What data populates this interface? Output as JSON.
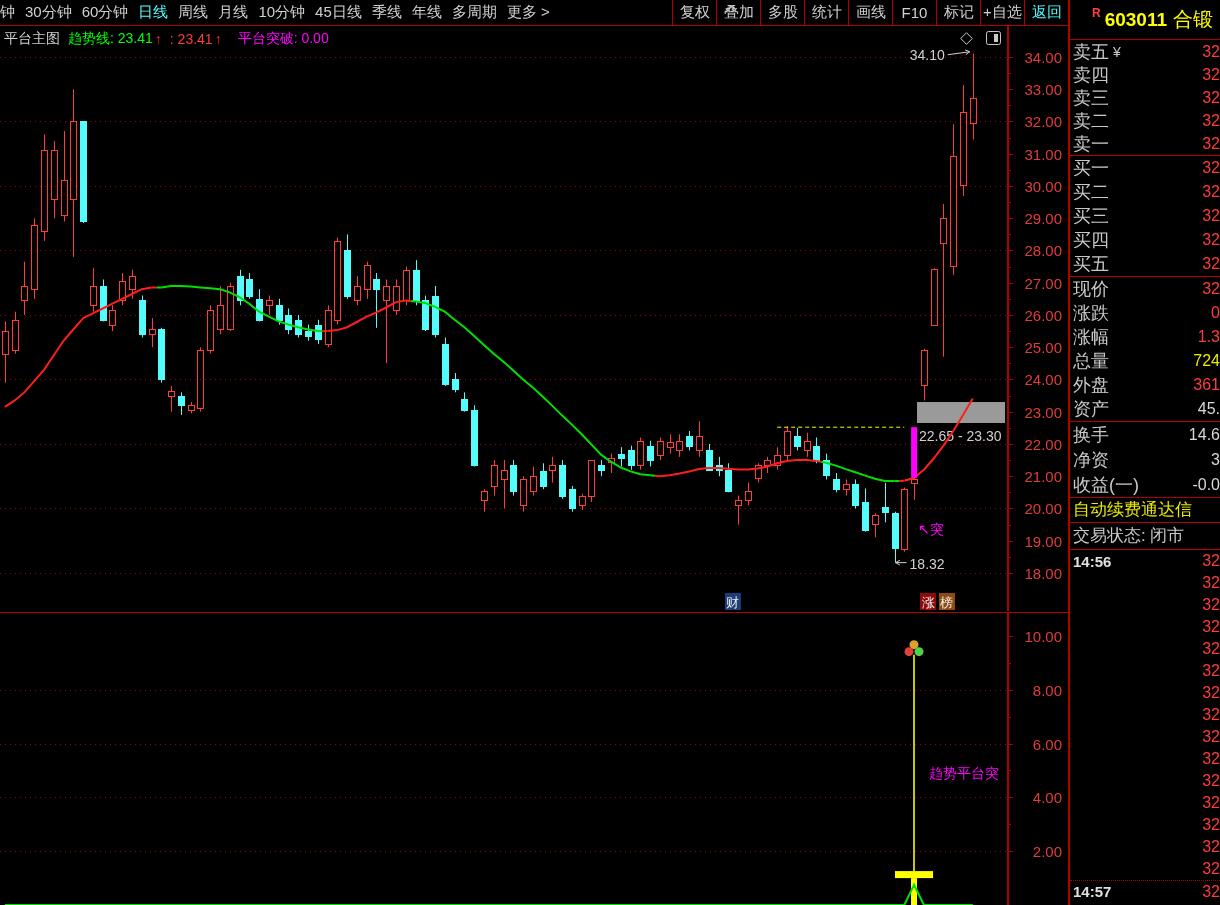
{
  "toolbar": {
    "periods": [
      {
        "label": "钟",
        "selected": false
      },
      {
        "label": "30分钟",
        "selected": false
      },
      {
        "label": "60分钟",
        "selected": false
      },
      {
        "label": "日线",
        "selected": true
      },
      {
        "label": "周线",
        "selected": false
      },
      {
        "label": "月线",
        "selected": false
      },
      {
        "label": "10分钟",
        "selected": false
      },
      {
        "label": "45日线",
        "selected": false
      },
      {
        "label": "季线",
        "selected": false
      },
      {
        "label": "年线",
        "selected": false
      },
      {
        "label": "多周期",
        "selected": false
      },
      {
        "label": "更多 >",
        "selected": false
      }
    ],
    "buttons": [
      {
        "label": "复权",
        "kind": "tool"
      },
      {
        "label": "叠加",
        "kind": "tool"
      },
      {
        "label": "多股",
        "kind": "tool"
      },
      {
        "label": "统计",
        "kind": "tool"
      },
      {
        "label": "画线",
        "kind": "tool"
      },
      {
        "label": "F10",
        "kind": "tool"
      },
      {
        "label": "标记",
        "kind": "tool"
      },
      {
        "label": "+自选",
        "kind": "tool"
      },
      {
        "label": "返回",
        "kind": "back"
      }
    ]
  },
  "chart": {
    "legend": {
      "title": "平台主图",
      "items": [
        {
          "label": "趋势线: 23.41",
          "arrow": "↑",
          "color": "#00ff00"
        },
        {
          "label": ": 23.41",
          "arrow": "↑",
          "color": "#ff3c3c"
        },
        {
          "label": "平台突破: 0.00",
          "color": "#ff00ff"
        }
      ]
    },
    "chart_data": {
      "type": "candlestick",
      "ylim": [
        16.82,
        34.96
      ],
      "grid": true,
      "yticks": [
        {
          "value": 34,
          "label": "34.00"
        },
        {
          "value": 33,
          "label": "33.00"
        },
        {
          "value": 32,
          "label": "32.00"
        },
        {
          "value": 31,
          "label": "31.00"
        },
        {
          "value": 30,
          "label": "30.00"
        },
        {
          "value": 29,
          "label": "29.00"
        },
        {
          "value": 28,
          "label": "28.00"
        },
        {
          "value": 27,
          "label": "27.00"
        },
        {
          "value": 26,
          "label": "26.00"
        },
        {
          "value": 25,
          "label": "25.00"
        },
        {
          "value": 24,
          "label": "24.00"
        },
        {
          "value": 23,
          "label": "23.00"
        },
        {
          "value": 22,
          "label": "22.00"
        },
        {
          "value": 21,
          "label": "21.00"
        },
        {
          "value": 20,
          "label": "20.00"
        },
        {
          "value": 19,
          "label": "19.00"
        },
        {
          "value": 18,
          "label": "18.00"
        }
      ],
      "series": [
        {
          "ohlc": [
            [
              24.8,
              25.8,
              23.9,
              25.5
            ],
            [
              24.9,
              26.1,
              24.8,
              25.85
            ],
            [
              26.45,
              27.65,
              26.0,
              26.9
            ],
            [
              26.8,
              29.0,
              26.5,
              28.8
            ],
            [
              28.6,
              31.6,
              28.3,
              31.1
            ],
            [
              29.6,
              31.4,
              29.0,
              31.1
            ],
            [
              29.1,
              31.7,
              28.9,
              30.2
            ],
            [
              29.6,
              33.0,
              27.8,
              32.0
            ],
            [
              32.0,
              32.0,
              28.85,
              28.9
            ],
            [
              26.3,
              27.45,
              26.1,
              26.9
            ],
            [
              26.9,
              27.1,
              25.8,
              25.85
            ],
            [
              25.7,
              26.3,
              25.5,
              26.15
            ],
            [
              26.45,
              27.3,
              26.3,
              27.05
            ],
            [
              26.8,
              27.4,
              26.5,
              27.2
            ],
            [
              26.45,
              26.6,
              25.3,
              25.4
            ],
            [
              25.4,
              25.9,
              25.0,
              25.55
            ],
            [
              25.55,
              25.6,
              23.9,
              24.0
            ],
            [
              23.5,
              23.8,
              23.0,
              23.65
            ],
            [
              23.5,
              23.6,
              22.9,
              23.2
            ],
            [
              23.05,
              23.3,
              22.95,
              23.2
            ],
            [
              23.1,
              25.0,
              23.0,
              24.9
            ],
            [
              24.9,
              26.3,
              24.8,
              26.15
            ],
            [
              25.55,
              26.9,
              25.4,
              26.3
            ],
            [
              25.55,
              27.0,
              25.5,
              26.9
            ],
            [
              27.2,
              27.4,
              26.3,
              26.45
            ],
            [
              27.1,
              27.3,
              26.5,
              26.6
            ],
            [
              26.5,
              26.8,
              25.8,
              25.85
            ],
            [
              26.3,
              26.6,
              26.0,
              26.45
            ],
            [
              26.3,
              26.5,
              25.7,
              25.85
            ],
            [
              26.0,
              26.2,
              25.4,
              25.55
            ],
            [
              25.85,
              26.0,
              25.3,
              25.4
            ],
            [
              25.5,
              25.7,
              25.2,
              25.35
            ],
            [
              25.7,
              25.85,
              25.1,
              25.25
            ],
            [
              25.1,
              26.3,
              25.0,
              26.15
            ],
            [
              25.85,
              28.4,
              25.7,
              28.3
            ],
            [
              28.0,
              28.5,
              26.5,
              26.6
            ],
            [
              26.45,
              27.2,
              26.3,
              26.9
            ],
            [
              26.8,
              27.65,
              26.5,
              27.55
            ],
            [
              27.1,
              27.3,
              25.6,
              26.8
            ],
            [
              26.45,
              27.1,
              24.5,
              26.9
            ],
            [
              26.15,
              27.1,
              26.0,
              26.9
            ],
            [
              26.45,
              27.5,
              26.3,
              27.4
            ],
            [
              27.4,
              27.7,
              26.3,
              26.45
            ],
            [
              26.45,
              26.6,
              25.5,
              25.55
            ],
            [
              26.6,
              26.9,
              25.3,
              25.4
            ],
            [
              25.1,
              25.3,
              23.8,
              23.85
            ],
            [
              24.0,
              24.2,
              23.6,
              23.7
            ],
            [
              23.4,
              23.6,
              23.0,
              23.05
            ],
            [
              23.05,
              23.2,
              21.3,
              21.35
            ],
            [
              20.25,
              20.6,
              19.9,
              20.55
            ],
            [
              20.7,
              21.5,
              20.4,
              21.35
            ],
            [
              20.9,
              21.5,
              20.0,
              21.2
            ],
            [
              21.35,
              21.5,
              20.4,
              20.55
            ],
            [
              20.1,
              21.0,
              19.9,
              20.9
            ],
            [
              20.55,
              21.3,
              20.4,
              21.0
            ],
            [
              21.15,
              21.4,
              20.6,
              20.7
            ],
            [
              21.2,
              21.6,
              20.8,
              21.35
            ],
            [
              21.35,
              21.5,
              20.3,
              20.4
            ],
            [
              20.6,
              20.7,
              19.9,
              20.0
            ],
            [
              20.1,
              20.45,
              19.95,
              20.4
            ],
            [
              20.4,
              21.5,
              20.2,
              21.5
            ],
            [
              21.35,
              21.5,
              21.0,
              21.2
            ],
            [
              21.45,
              21.7,
              21.1,
              21.55
            ],
            [
              21.7,
              21.9,
              21.3,
              21.55
            ],
            [
              21.8,
              21.95,
              21.2,
              21.35
            ],
            [
              21.35,
              22.2,
              21.2,
              22.1
            ],
            [
              21.95,
              22.1,
              21.3,
              21.5
            ],
            [
              21.65,
              22.2,
              21.5,
              22.1
            ],
            [
              21.9,
              22.3,
              21.7,
              22.05
            ],
            [
              21.8,
              22.3,
              21.6,
              22.1
            ],
            [
              22.25,
              22.4,
              21.8,
              21.95
            ],
            [
              21.8,
              22.7,
              21.6,
              22.25
            ],
            [
              21.8,
              22.0,
              21.2,
              21.2
            ],
            [
              21.35,
              21.6,
              21.0,
              21.2
            ],
            [
              21.2,
              21.4,
              20.5,
              20.55
            ],
            [
              20.1,
              20.4,
              19.5,
              20.25
            ],
            [
              20.25,
              20.8,
              20.1,
              20.55
            ],
            [
              20.95,
              21.4,
              20.8,
              21.35
            ],
            [
              21.35,
              21.6,
              21.1,
              21.5
            ],
            [
              21.35,
              21.9,
              21.2,
              21.65
            ],
            [
              21.65,
              22.55,
              21.5,
              22.4
            ],
            [
              22.25,
              22.5,
              21.8,
              21.95
            ],
            [
              21.8,
              22.35,
              21.6,
              22.1
            ],
            [
              21.95,
              22.2,
              21.4,
              21.5
            ],
            [
              21.5,
              21.7,
              20.9,
              21.05
            ],
            [
              20.9,
              21.1,
              20.5,
              20.6
            ],
            [
              20.6,
              20.9,
              20.4,
              20.75
            ],
            [
              20.75,
              20.9,
              20.0,
              20.1
            ],
            [
              20.21,
              20.62,
              19.28,
              19.34
            ],
            [
              19.51,
              19.85,
              19.1,
              19.8
            ],
            [
              20.04,
              20.79,
              19.57,
              19.9
            ],
            [
              19.86,
              19.9,
              18.32,
              18.76
            ],
            [
              18.73,
              20.65,
              18.66,
              20.6
            ],
            [
              20.8,
              21.0,
              20.27,
              20.9
            ],
            [
              23.82,
              24.95,
              23.35,
              24.92
            ],
            [
              25.68,
              27.45,
              25.68,
              27.43
            ],
            [
              28.24,
              29.44,
              24.71,
              29.02
            ],
            [
              27.51,
              31.91,
              27.23,
              30.92
            ],
            [
              30.04,
              33.13,
              29.69,
              32.28
            ],
            [
              31.96,
              34.1,
              31.44,
              32.74
            ],
            null,
            null,
            null
          ]
        },
        {
          "type": "line",
          "color": "#00e000",
          "values": [
            null,
            null,
            null,
            null,
            null,
            null,
            null,
            null,
            null,
            null,
            null,
            null,
            null,
            null,
            null,
            null,
            26.85,
            26.9,
            26.9,
            26.88,
            26.85,
            26.83,
            26.8,
            26.7,
            26.55,
            26.35,
            26.1,
            25.95,
            25.8,
            25.7,
            25.62,
            25.55,
            25.5,
            null,
            null,
            null,
            null,
            null,
            null,
            null,
            null,
            null,
            26.42,
            26.37,
            26.25,
            26.1,
            25.85,
            25.62,
            25.35,
            25.07,
            24.8,
            24.55,
            24.28,
            24.0,
            23.75,
            23.47,
            23.18,
            22.88,
            22.6,
            22.3,
            21.98,
            21.66,
            21.45,
            21.27,
            21.15,
            21.06,
            21.03,
            null,
            null,
            null,
            null,
            null,
            null,
            null,
            null,
            null,
            null,
            null,
            null,
            null,
            null,
            null,
            null,
            null,
            21.42,
            21.33,
            21.22,
            21.12,
            21.02,
            20.92,
            20.85,
            20.85,
            null,
            null,
            null,
            null,
            null,
            null,
            null,
            null,
            null,
            null,
            null
          ]
        },
        {
          "type": "line",
          "color": "#ff1e1e",
          "values": [
            23.15,
            23.35,
            23.6,
            23.95,
            24.3,
            24.75,
            25.2,
            25.55,
            25.9,
            26.05,
            26.2,
            26.35,
            26.5,
            26.65,
            26.8,
            26.85,
            null,
            null,
            null,
            null,
            null,
            null,
            null,
            null,
            null,
            null,
            null,
            null,
            null,
            null,
            null,
            null,
            null,
            25.5,
            25.53,
            25.62,
            25.78,
            25.95,
            26.08,
            26.23,
            26.4,
            26.45,
            null,
            null,
            null,
            null,
            null,
            null,
            null,
            null,
            null,
            null,
            null,
            null,
            null,
            null,
            null,
            null,
            null,
            null,
            null,
            null,
            null,
            null,
            null,
            null,
            null,
            21.0,
            21.03,
            21.08,
            21.15,
            21.22,
            21.25,
            21.25,
            21.23,
            21.21,
            21.21,
            21.24,
            21.3,
            21.4,
            21.47,
            21.5,
            21.5,
            21.47,
            null,
            null,
            null,
            null,
            null,
            null,
            null,
            null,
            20.86,
            20.95,
            21.2,
            21.55,
            21.95,
            22.4,
            22.9,
            23.41,
            null,
            null,
            null
          ]
        },
        {
          "type": "line",
          "color": "#ffff00",
          "line_style": "dashed",
          "values": [
            null,
            null,
            null,
            null,
            null,
            null,
            null,
            null,
            null,
            null,
            null,
            null,
            null,
            null,
            null,
            null,
            null,
            null,
            null,
            null,
            null,
            null,
            null,
            null,
            null,
            null,
            null,
            null,
            null,
            null,
            null,
            null,
            null,
            null,
            null,
            null,
            null,
            null,
            null,
            null,
            null,
            null,
            null,
            null,
            null,
            null,
            null,
            null,
            null,
            null,
            null,
            null,
            null,
            null,
            null,
            null,
            null,
            null,
            null,
            null,
            null,
            null,
            null,
            null,
            null,
            null,
            null,
            null,
            null,
            null,
            null,
            null,
            null,
            null,
            null,
            null,
            null,
            null,
            null,
            22.52,
            22.52,
            22.52,
            22.52,
            22.52,
            22.52,
            22.52,
            22.52,
            22.52,
            22.52,
            22.52,
            22.52,
            22.52,
            22.52,
            null,
            null,
            null,
            null,
            null,
            null,
            null,
            null,
            null,
            null
          ]
        }
      ],
      "bands": [
        {
          "axis": "y",
          "from": 22.65,
          "to": 23.3,
          "label": "22.65 - 23.30"
        }
      ],
      "annotations": [
        "34.10",
        "18.32",
        "↖突"
      ]
    },
    "events": [
      {
        "text": "财",
        "color": "#1c3d7a"
      },
      {
        "text": "涨",
        "color": "#8c0c0c"
      },
      {
        "text": "榜",
        "color": "#8c4c10"
      }
    ]
  },
  "sub_chart": {
    "chart_data": {
      "type": "line",
      "ylim": [
        0,
        10.89
      ],
      "grid": true,
      "yticks": [
        {
          "value": 10,
          "label": "10.00"
        },
        {
          "value": 8,
          "label": "8.00"
        },
        {
          "value": 6,
          "label": "6.00"
        },
        {
          "value": 4,
          "label": "4.00"
        },
        {
          "value": 2,
          "label": "2.00"
        }
      ],
      "series": [
        {
          "color": "#00e000",
          "values": [
            0,
            0,
            0,
            0,
            0,
            0,
            0,
            0,
            0,
            0,
            0,
            0,
            0,
            0,
            0,
            0,
            0,
            0,
            0,
            0,
            0,
            0,
            0,
            0,
            0,
            0,
            0,
            0,
            0,
            0,
            0,
            0,
            0,
            0,
            0,
            0,
            0,
            0,
            0,
            0,
            0,
            0,
            0,
            0,
            0,
            0,
            0,
            0,
            0,
            0,
            0,
            0,
            0,
            0,
            0,
            0,
            0,
            0,
            0,
            0,
            0,
            0,
            0,
            0,
            0,
            0,
            0,
            0,
            0,
            0,
            0,
            0,
            0,
            0,
            0,
            0,
            0,
            0,
            0,
            0,
            0,
            0,
            0,
            0,
            0,
            0,
            0,
            0,
            0,
            0,
            0,
            0,
            0,
            0.75,
            0,
            0,
            0,
            0,
            0,
            0,
            null,
            null,
            null
          ]
        },
        {
          "type": "bar",
          "color": "#ffff00",
          "values": [
            null,
            null,
            null,
            null,
            null,
            null,
            null,
            null,
            null,
            null,
            null,
            null,
            null,
            null,
            null,
            null,
            null,
            null,
            null,
            null,
            null,
            null,
            null,
            null,
            null,
            null,
            null,
            null,
            null,
            null,
            null,
            null,
            null,
            null,
            null,
            null,
            null,
            null,
            null,
            null,
            null,
            null,
            null,
            null,
            null,
            null,
            null,
            null,
            null,
            null,
            null,
            null,
            null,
            null,
            null,
            null,
            null,
            null,
            null,
            null,
            null,
            null,
            null,
            null,
            null,
            null,
            null,
            null,
            null,
            null,
            null,
            null,
            null,
            null,
            null,
            null,
            null,
            null,
            null,
            null,
            null,
            null,
            null,
            null,
            null,
            null,
            null,
            null,
            null,
            null,
            null,
            null,
            null,
            1.0,
            null,
            null,
            null,
            null,
            null,
            null,
            null,
            null,
            null
          ]
        }
      ],
      "annotations": [
        "趋势平台突"
      ]
    }
  },
  "quote": {
    "badge": "R",
    "code": "603011",
    "name": "合锻",
    "sell": [
      {
        "label": "卖五",
        "tag": "¥",
        "value": "32"
      },
      {
        "label": "卖四",
        "value": "32"
      },
      {
        "label": "卖三",
        "value": "32"
      },
      {
        "label": "卖二",
        "value": "32"
      },
      {
        "label": "卖一",
        "value": "32"
      }
    ],
    "buy": [
      {
        "label": "买一",
        "value": "32"
      },
      {
        "label": "买二",
        "value": "32"
      },
      {
        "label": "买三",
        "value": "32"
      },
      {
        "label": "买四",
        "value": "32"
      },
      {
        "label": "买五",
        "value": "32"
      }
    ],
    "stats": [
      {
        "label": "现价",
        "value": "32",
        "color": "#ff3c3c"
      },
      {
        "label": "涨跌",
        "value": "0",
        "color": "#ff3c3c"
      },
      {
        "label": "涨幅",
        "value": "1.3",
        "color": "#ff3c3c"
      },
      {
        "label": "总量",
        "value": "724",
        "color": "#e8e800"
      },
      {
        "label": "外盘",
        "value": "361",
        "color": "#ff3c3c"
      },
      {
        "label": "资产",
        "value": "45.",
        "color": "#d8d8d8"
      }
    ],
    "finance": [
      {
        "label": "换手",
        "value": "14.6"
      },
      {
        "label": "净资",
        "value": "3"
      },
      {
        "label": "收益(一)",
        "value": "-0.0"
      }
    ],
    "notice": "自动续费通达信",
    "status": "交易状态: 闭市",
    "ticks": [
      {
        "time": "14:56",
        "price": "32"
      },
      {
        "price": "32"
      },
      {
        "price": "32"
      },
      {
        "price": "32"
      },
      {
        "price": "32"
      },
      {
        "price": "32"
      },
      {
        "price": "32"
      },
      {
        "price": "32"
      },
      {
        "price": "32"
      },
      {
        "price": "32"
      },
      {
        "price": "32"
      },
      {
        "price": "32"
      },
      {
        "price": "32"
      },
      {
        "price": "32"
      },
      {
        "price": "32"
      },
      {
        "time": "14:57",
        "price": "32"
      }
    ]
  }
}
